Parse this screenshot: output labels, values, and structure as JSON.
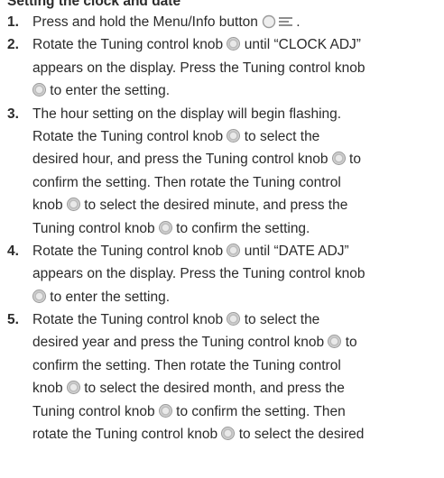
{
  "section_title": "Setting the clock and date",
  "steps": [
    {
      "number": "1.",
      "lines": [
        [
          "Press and hold the Menu/Info button ",
          "{menu}",
          "."
        ]
      ]
    },
    {
      "number": "2.",
      "lines": [
        [
          "Rotate the Tuning control knob ",
          "{knob}",
          " until “CLOCK ADJ”"
        ],
        [
          "appears on the display. Press the Tuning control knob"
        ],
        [
          "{knob}",
          " to enter the setting."
        ]
      ]
    },
    {
      "number": "3.",
      "lines": [
        [
          "The hour setting on the display will begin flashing."
        ],
        [
          "Rotate the Tuning control knob ",
          "{knob}",
          " to select the"
        ],
        [
          "desired hour, and press the Tuning control knob ",
          "{knob}",
          " to"
        ],
        [
          "confirm the setting. Then rotate the Tuning control"
        ],
        [
          "knob ",
          "{knob}",
          " to select the desired minute, and press the"
        ],
        [
          "Tuning control knob ",
          "{knob}",
          " to confirm the setting."
        ]
      ]
    },
    {
      "number": "4.",
      "lines": [
        [
          "Rotate the Tuning control knob ",
          "{knob}",
          " until “DATE ADJ”"
        ],
        [
          "appears on the display. Press the Tuning control knob"
        ],
        [
          "{knob}",
          " to enter the setting."
        ]
      ]
    },
    {
      "number": "5.",
      "lines": [
        [
          "Rotate the Tuning control knob ",
          "{knob}",
          " to select the"
        ],
        [
          "desired year and press the Tuning control knob ",
          "{knob}",
          " to"
        ],
        [
          "confirm the setting. Then rotate the Tuning control"
        ],
        [
          "knob ",
          "{knob}",
          " to select the desired month, and press the"
        ],
        [
          "Tuning control knob ",
          "{knob}",
          " to confirm the setting. Then"
        ],
        [
          "rotate the Tuning control knob ",
          "{knob}",
          " to select the desired"
        ]
      ]
    }
  ],
  "icons": {
    "knob": "tuning-knob-icon",
    "menu": "menu-info-button-icon"
  }
}
